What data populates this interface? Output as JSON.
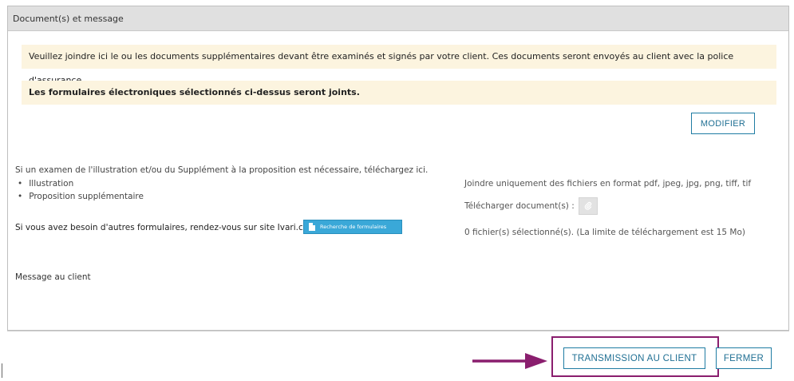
{
  "panel": {
    "title": "Document(s) et message"
  },
  "notices": {
    "instructions": "Veuillez joindre ici le ou les documents supplémentaires devant être examinés et signés par votre client. Ces documents seront envoyés au client avec la police d'assurance.",
    "forms_attached": "Les formulaires électroniques sélectionnés ci-dessus seront joints."
  },
  "buttons": {
    "modifier": "MODIFIER",
    "recherche": "Recherche de formulaires",
    "transmission": "TRANSMISSION AU CLIENT",
    "fermer": "FERMER"
  },
  "left": {
    "exam_text": "Si un examen de l'illustration et/ou du Supplément à la proposition est nécessaire, téléchargez ici.",
    "bullets": [
      "Illustration",
      "Proposition supplémentaire"
    ],
    "other_forms": "Si vous avez besoin d'autres formulaires, rendez-vous sur site Ivari.ca.",
    "message_label": "Message au client"
  },
  "right": {
    "formats": "Joindre uniquement des fichiers en format pdf, jpeg, jpg, png, tiff, tif",
    "upload_label": "Télécharger document(s) :",
    "selected": "0 fichier(s) sélectionné(s). (La limite de téléchargement est 15 Mo)"
  },
  "icons": {
    "upload": "paperclip-icon",
    "recherche": "document-icon",
    "annotation": "arrow-right-icon"
  },
  "colors": {
    "accent": "#1f7ca3",
    "notice_bg": "#fcf4df",
    "highlight": "#8a1e6e",
    "blue_button": "#3aa8d8"
  }
}
